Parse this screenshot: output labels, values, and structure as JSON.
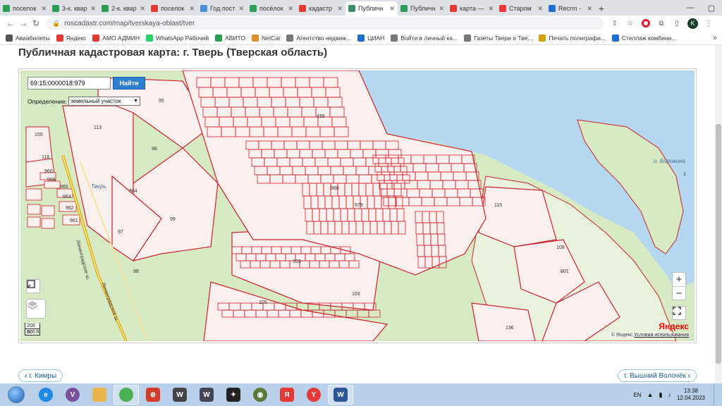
{
  "tabs": [
    {
      "title": "поселок",
      "color": "#2a9d52",
      "active": false
    },
    {
      "title": "3-к. квар",
      "color": "#2a9d52",
      "active": false
    },
    {
      "title": "2-к. квар",
      "color": "#2a9d52",
      "active": false
    },
    {
      "title": "поселок",
      "color": "#e53935",
      "active": false
    },
    {
      "title": "Год пост",
      "color": "#4a90d9",
      "active": false
    },
    {
      "title": "посёлок",
      "color": "#2e9e5a",
      "active": false
    },
    {
      "title": "кадастр",
      "color": "#e53935",
      "active": false
    },
    {
      "title": "Публичн",
      "color": "#3b8f6a",
      "active": true
    },
    {
      "title": "Публичн",
      "color": "#2e9e5a",
      "active": false
    },
    {
      "title": "карта —",
      "color": "#e53935",
      "active": false
    },
    {
      "title": "Старом",
      "color": "#e53935",
      "active": false
    },
    {
      "title": "Recrm - ",
      "color": "#1e6fd0",
      "active": false
    }
  ],
  "address": {
    "url": "roscadastr.com/map/tverskaya-oblast/tver"
  },
  "profile_initial": "K",
  "bookmarks": [
    {
      "label": "Авиабилеты",
      "color": "#555"
    },
    {
      "label": "Яндекс",
      "color": "#e53935"
    },
    {
      "label": "АМО АДМИН",
      "color": "#e53935"
    },
    {
      "label": "WhatsApp Рабочий",
      "color": "#25d366"
    },
    {
      "label": "АВИТО",
      "color": "#2a9d52"
    },
    {
      "label": "NetCat",
      "color": "#e0902a"
    },
    {
      "label": "Агентство недвиж...",
      "color": "#777"
    },
    {
      "label": "ЦИАН",
      "color": "#1e6fd0"
    },
    {
      "label": "Войти в личный ка...",
      "color": "#777"
    },
    {
      "label": "Газеты Твери и Тве...",
      "color": "#777"
    },
    {
      "label": "Печать полиграфи...",
      "color": "#d4a000"
    },
    {
      "label": "Стеллаж комбини...",
      "color": "#1e6fd0"
    }
  ],
  "page": {
    "title": "Публичная кадастровая карта: г. Тверь (Тверская область)",
    "prev_label": "г. Кимры",
    "next_label": "г. Вышний Волочёк"
  },
  "map": {
    "search_value": "69:15:0000018:979",
    "search_button": "Найти",
    "definition_label": "Определение:",
    "definition_value": "земельный участок",
    "scale_m": "200 m",
    "scale_ft": "500 ft",
    "logo": "Яндекс",
    "attribution": "© Яндекс",
    "terms_link": "Условия использования",
    "labels": [
      "95",
      "113",
      "155",
      "118",
      "96",
      "364",
      "960",
      "958",
      "965",
      "964",
      "962",
      "961",
      "99",
      "97",
      "98",
      "103",
      "103",
      "105",
      "108",
      "801",
      "115",
      "439",
      "979",
      "980",
      "1",
      "136",
      "о. Боровина",
      "Тверь",
      "Ленинградское ш.",
      "Ленинградское ш."
    ]
  },
  "taskbar": {
    "apps": [
      {
        "name": "ie",
        "color": "#1e88e5",
        "glyph": "e"
      },
      {
        "name": "viber",
        "color": "#7b519d",
        "glyph": "V"
      },
      {
        "name": "folder",
        "color": "#e8b64a",
        "glyph": ""
      },
      {
        "name": "chrome",
        "color": "#4caf50",
        "glyph": ""
      },
      {
        "name": "app",
        "color": "#d43b2b",
        "glyph": "⊕"
      },
      {
        "name": "wot",
        "color": "#444",
        "glyph": "W"
      },
      {
        "name": "wows",
        "color": "#445",
        "glyph": "W"
      },
      {
        "name": "game",
        "color": "#222",
        "glyph": "✦"
      },
      {
        "name": "gamecenter",
        "color": "#5a7a3a",
        "glyph": "◉"
      },
      {
        "name": "yandex",
        "color": "#e53935",
        "glyph": "Я"
      },
      {
        "name": "yabrowser",
        "color": "#e53935",
        "glyph": "Y"
      },
      {
        "name": "word",
        "color": "#2b579a",
        "glyph": "W"
      }
    ],
    "lang": "EN",
    "time": "13:38",
    "date": "12.04.2023"
  }
}
